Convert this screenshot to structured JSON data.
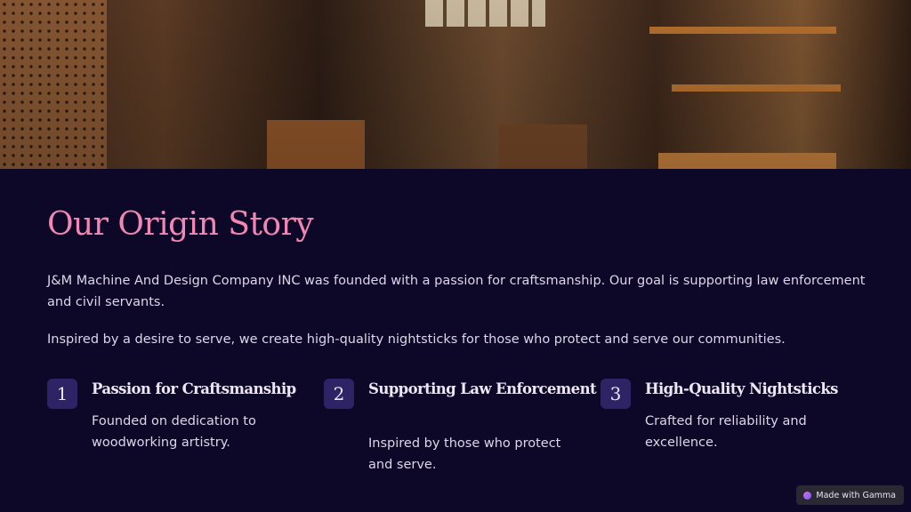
{
  "title": "Our Origin Story",
  "paragraphs": [
    "J&M Machine And Design Company INC was founded with a passion for craftsmanship. Our goal is supporting law enforcement and civil servants.",
    "Inspired by a desire to serve, we create high-quality nightsticks for those who protect and serve our communities."
  ],
  "features": [
    {
      "number": "1",
      "title": "Passion for Craftsmanship",
      "description": "Founded on dedication to woodworking artistry."
    },
    {
      "number": "2",
      "title": "Supporting Law Enforcement",
      "description": "Inspired by those who protect and serve."
    },
    {
      "number": "3",
      "title": "High-Quality Nightsticks",
      "description": "Crafted for reliability and excellence."
    }
  ],
  "badge": {
    "label": "Made with Gamma",
    "icon": "gamma-logo-icon"
  },
  "colors": {
    "background": "#0e0828",
    "title": "#f286b4",
    "number_box": "#2e2465",
    "text": "#ddd6ea"
  }
}
